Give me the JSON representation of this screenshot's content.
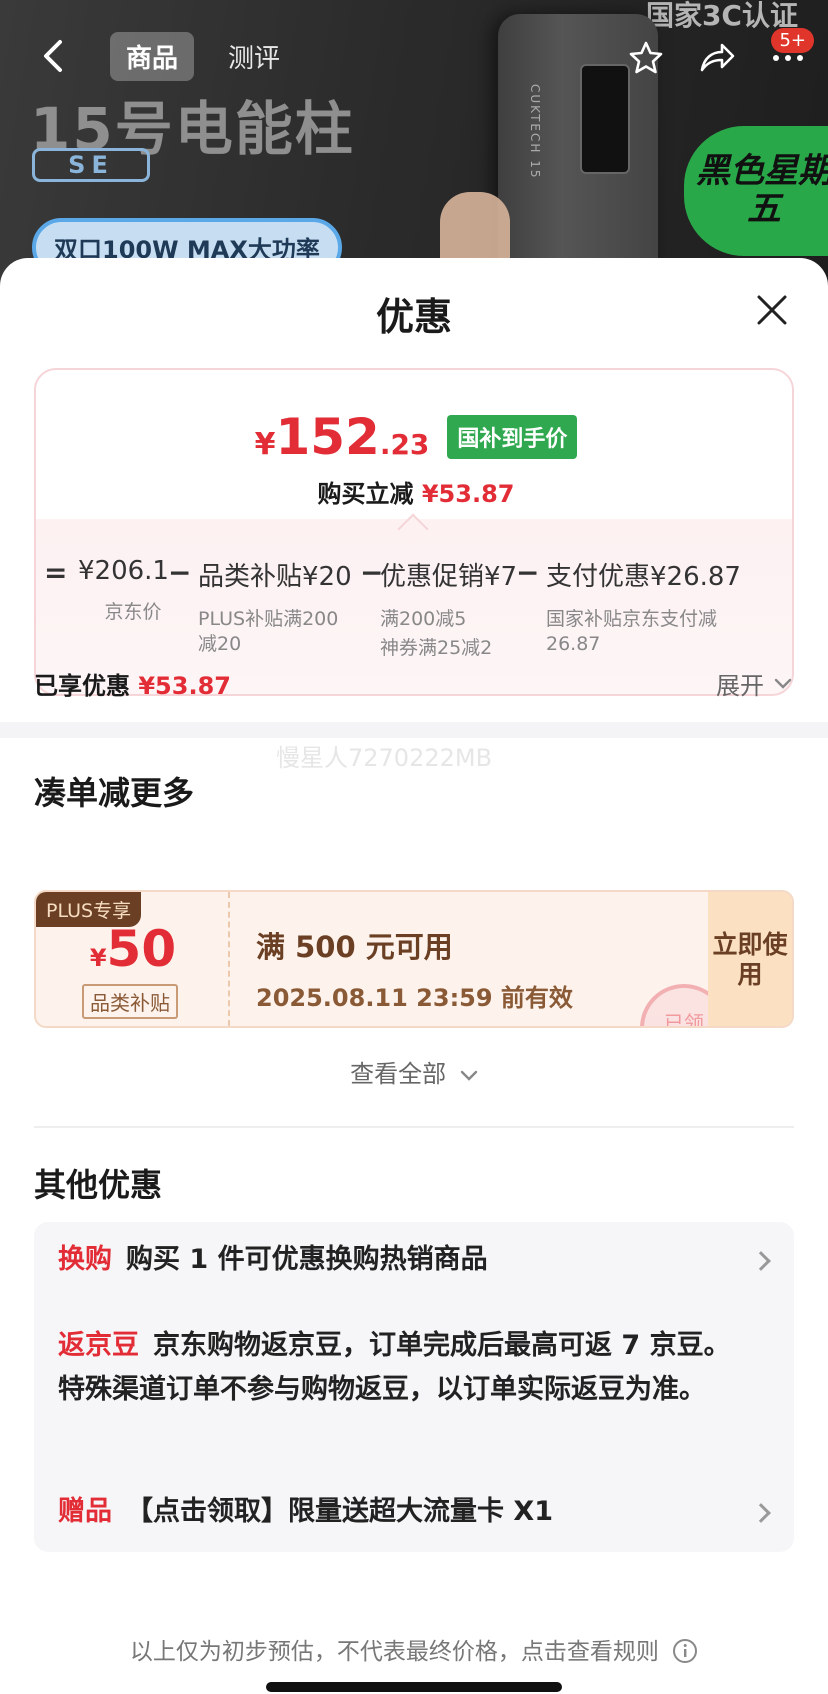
{
  "header": {
    "certification": "国家3C认证",
    "tabs": [
      {
        "label": "商品",
        "active": true
      },
      {
        "label": "测评",
        "active": false
      }
    ],
    "product_title": "15号电能柱",
    "product_model": "SE",
    "power_label": "双口100W MAX大功率",
    "promo_badge": "黑色星期五",
    "device_brand": "CUKTECH 15",
    "notification_count": "5+",
    "icons": [
      "back-icon",
      "star-icon",
      "share-icon",
      "more-icon"
    ]
  },
  "sheet": {
    "title": "优惠",
    "close_icon": "close-icon"
  },
  "price": {
    "currency": "¥",
    "integer": "152",
    "decimal": ".23",
    "gov_tag": "国补到手价",
    "instant_label": "购买立减",
    "instant_amount": "¥53.87"
  },
  "breakdown": {
    "equals": "=",
    "minus": "−",
    "items": [
      {
        "main": "¥206.1",
        "sub": [
          "京东价"
        ]
      },
      {
        "main": "品类补贴¥20",
        "sub": [
          "PLUS补贴满200",
          "减20"
        ]
      },
      {
        "main": "优惠促销¥7",
        "sub": [
          "满200减5",
          "神券满25减2"
        ]
      },
      {
        "main": "支付优惠¥26.87",
        "sub": [
          "国家补贴京东支付减",
          "26.87"
        ]
      }
    ]
  },
  "enjoyed": {
    "label": "已享优惠",
    "amount": "¥53.87",
    "expand_label": "展开"
  },
  "watermark": "慢星人7270222MB",
  "coupons_section": {
    "title": "凑单减更多",
    "coupon": {
      "tag": "PLUS专享",
      "currency": "¥",
      "amount": "50",
      "type": "品类补贴",
      "condition": "满 500 元可用",
      "valid": "2025.08.11 23:59 前有效",
      "button": "立即使用",
      "stamp": "已领"
    },
    "see_all": "查看全部"
  },
  "others_section": {
    "title": "其他优惠",
    "items": [
      {
        "tag": "换购",
        "text": "购买 1 件可优惠换购热销商品",
        "arrow": true
      },
      {
        "tag": "返京豆",
        "text": "京东购物返京豆，订单完成后最高可返 7 京豆。特殊渠道订单不参与购物返豆，以订单实际返豆为准。",
        "arrow": false
      },
      {
        "tag": "赠品",
        "text": "【点击领取】限量送超大流量卡 X1",
        "arrow": true
      }
    ]
  },
  "footer": {
    "text": "以上仅为初步预估，不代表最终价格，点击查看规则",
    "info_icon": "info-icon"
  },
  "colors": {
    "accent_red": "#e22d37",
    "gov_green": "#2fa84f",
    "coupon_brown": "#6b3f23"
  }
}
